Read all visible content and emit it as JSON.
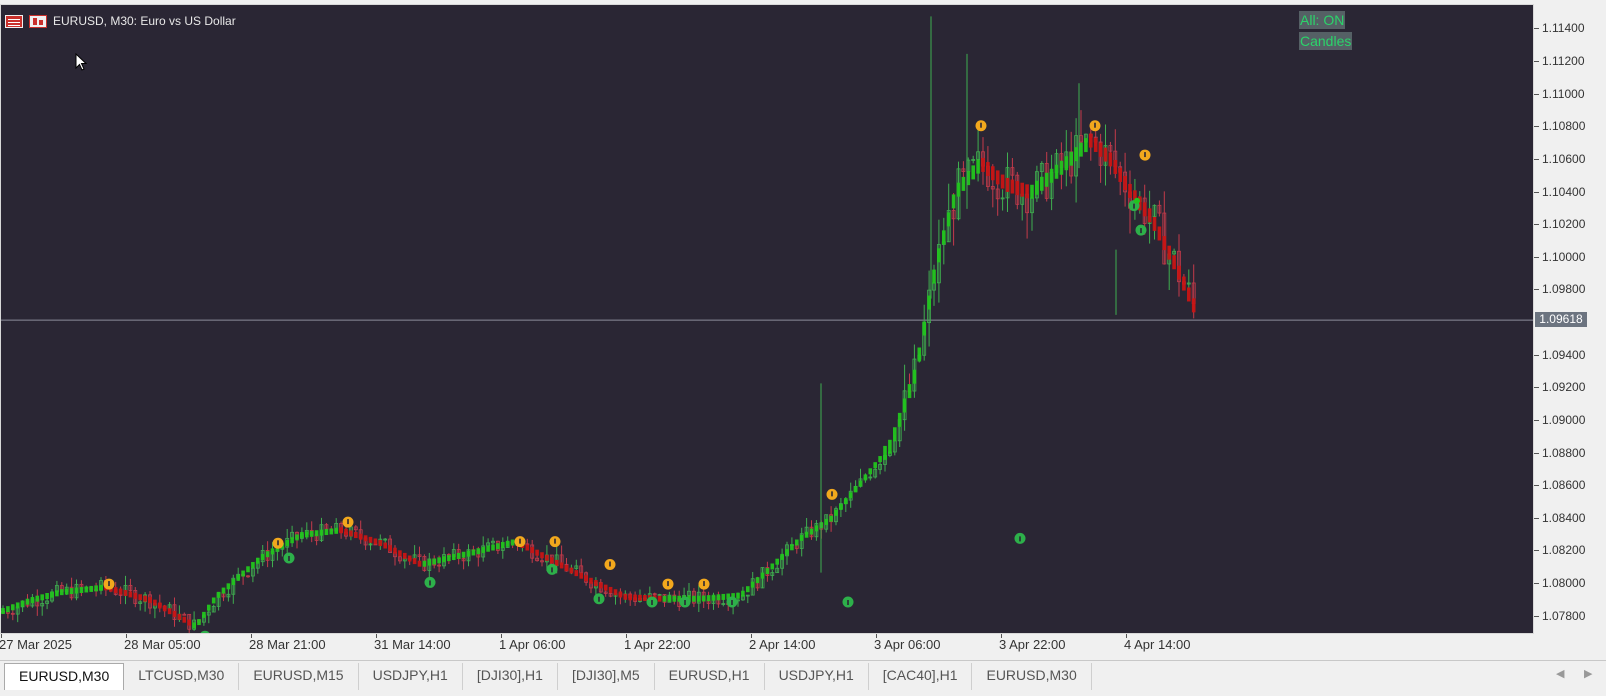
{
  "symbol": {
    "label": "EURUSD, M30:  Euro vs US Dollar"
  },
  "overlay_buttons": {
    "all": "All: ON",
    "candles": "Candles"
  },
  "price_axis": {
    "ticks": [
      "1.11400",
      "1.11200",
      "1.11000",
      "1.10800",
      "1.10600",
      "1.10400",
      "1.10200",
      "1.10000",
      "1.09800",
      "1.09400",
      "1.09200",
      "1.09000",
      "1.08800",
      "1.08600",
      "1.08400",
      "1.08200",
      "1.08000",
      "1.07800"
    ],
    "current_price": "1.09618"
  },
  "time_axis": {
    "labels": [
      "27 Mar 2025",
      "28 Mar 05:00",
      "28 Mar 21:00",
      "31 Mar 14:00",
      "1 Apr 06:00",
      "1 Apr 22:00",
      "2 Apr 14:00",
      "3 Apr 06:00",
      "3 Apr 22:00",
      "4 Apr 14:00"
    ]
  },
  "tabs": [
    "EURUSD,M30",
    "LTCUSD,M30",
    "EURUSD,M15",
    "USDJPY,H1",
    "[DJI30],H1",
    "[DJI30],M5",
    "EURUSD,H1",
    "USDJPY,H1",
    "[CAC40],H1",
    "EURUSD,M30"
  ],
  "active_tab": 0,
  "colors": {
    "background": "#2a2634",
    "bull": "#22c41e",
    "bear": "#c81414",
    "up_signal": "#2db04a",
    "down_signal": "#f2a81d",
    "up_wick": "#3fae4f",
    "down_wick": "#c43a4a"
  },
  "chart_data": {
    "type": "candlestick",
    "ylim": [
      1.077,
      1.1155
    ],
    "series": [
      {
        "name": "trend line",
        "x": [
          "27 Mar 2025",
          "28 Mar 05:00",
          "28 Mar 21:00",
          "31 Mar 14:00",
          "1 Apr 06:00",
          "1 Apr 22:00",
          "2 Apr 14:00",
          "3 Apr 06:00",
          "3 Apr 22:00",
          "4 Apr 14:00"
        ],
        "y": [
          1.0783,
          1.0793,
          1.0825,
          1.0818,
          1.0825,
          1.0795,
          1.0805,
          1.0935,
          1.1045,
          1.1005
        ]
      }
    ],
    "down_signals": [
      {
        "x": "28 Mar 00:00",
        "price": 1.08
      },
      {
        "x": "28 Mar 17:00",
        "price": 1.0825
      },
      {
        "x": "31 Mar 03:00",
        "price": 1.0838
      },
      {
        "x": "1 Apr 06:00",
        "price": 1.0826
      },
      {
        "x": "1 Apr 08:00",
        "price": 1.0826
      },
      {
        "x": "1 Apr 13:00",
        "price": 1.0812
      },
      {
        "x": "1 Apr 23:00",
        "price": 1.08
      },
      {
        "x": "2 Apr 02:00",
        "price": 1.08
      },
      {
        "x": "2 Apr 23:00",
        "price": 1.0855
      },
      {
        "x": "3 Apr 13:00",
        "price": 1.1081
      },
      {
        "x": "4 Apr 00:00",
        "price": 1.1081
      },
      {
        "x": "4 Apr 14:00",
        "price": 1.1063
      }
    ],
    "up_signals": [
      {
        "x": "28 Mar 11:00",
        "price": 1.0768
      },
      {
        "x": "28 Mar 19:00",
        "price": 1.0816
      },
      {
        "x": "31 Mar 18:00",
        "price": 1.0801
      },
      {
        "x": "1 Apr 08:00",
        "price": 1.0809
      },
      {
        "x": "1 Apr 11:00",
        "price": 1.0791
      },
      {
        "x": "1 Apr 18:00",
        "price": 1.0789
      },
      {
        "x": "1 Apr 19:00",
        "price": 1.0789
      },
      {
        "x": "1 Apr 22:00",
        "price": 1.0789
      },
      {
        "x": "2 Apr 05:00",
        "price": 1.0789
      },
      {
        "x": "3 Apr 02:00",
        "price": 1.0828
      },
      {
        "x": "3 Apr 20:00",
        "price": 1.1032
      },
      {
        "x": "4 Apr 12:00",
        "price": 1.1017
      }
    ]
  }
}
